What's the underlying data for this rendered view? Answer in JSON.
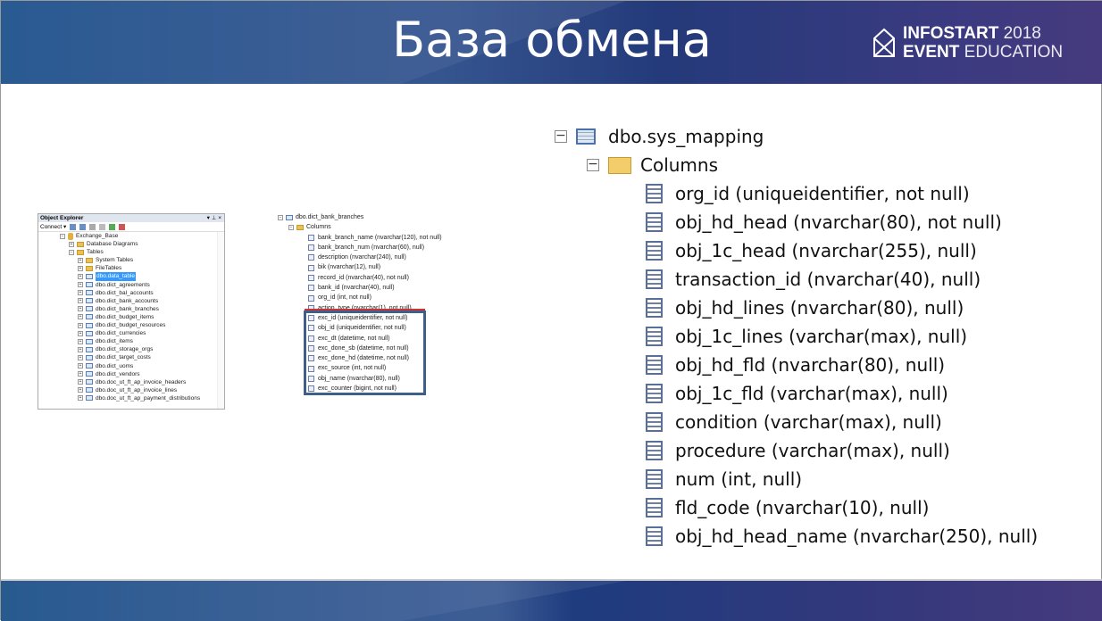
{
  "slide": {
    "title": "База обмена",
    "logo": {
      "line1_bold": "INFOSTART",
      "line1_light": "2018",
      "line2_bold": "EVENT",
      "line2_light": "EDUCATION"
    }
  },
  "object_explorer": {
    "title": "Object Explorer",
    "title_controls": "▾ ⊥ ×",
    "connect_label": "Connect ▾",
    "database": "Exchange_Base",
    "folders": [
      "Database Diagrams",
      "Tables"
    ],
    "sub_folders": [
      "System Tables",
      "FileTables"
    ],
    "tables": [
      "dbo.data_table",
      "dbo.dict_agreements",
      "dbo.dict_bal_accounts",
      "dbo.dict_bank_accounts",
      "dbo.dict_bank_branches",
      "dbo.dict_budget_items",
      "dbo.dict_budget_resources",
      "dbo.dict_currencies",
      "dbo.dict_items",
      "dbo.dict_storage_orgs",
      "dbo.dict_target_costs",
      "dbo.dict_uoms",
      "dbo.dict_vendors",
      "dbo.doc_ut_ft_ap_invoice_headers",
      "dbo.doc_ut_ft_ap_invoice_lines",
      "dbo.doc_ut_ft_ap_payment_distributions"
    ]
  },
  "bank_branches": {
    "table": "dbo.dict_bank_branches",
    "folder": "Columns",
    "columns": [
      "bank_branch_name (nvarchar(120), not null)",
      "bank_branch_num (nvarchar(60), null)",
      "description (nvarchar(240), null)",
      "bik (nvarchar(12), null)",
      "record_id (nvarchar(40), not null)",
      "bank_id (nvarchar(40), null)",
      "org_id (int, not null)",
      "action_type (nvarchar(1), not null)"
    ],
    "exchange_columns": [
      "exc_id (uniqueidentifier, not null)",
      "obj_id (uniqueidentifier, not null)",
      "exc_dt (datetime, not null)",
      "exc_done_sb (datetime, not null)",
      "exc_done_hd (datetime, not null)",
      "exc_source (int, not null)",
      "obj_name (nvarchar(80), null)",
      "exc_counter (bigint, not null)"
    ]
  },
  "sys_mapping": {
    "table": "dbo.sys_mapping",
    "folder": "Columns",
    "columns": [
      "org_id (uniqueidentifier, not null)",
      "obj_hd_head (nvarchar(80), not null)",
      "obj_1c_head (nvarchar(255), null)",
      "transaction_id (nvarchar(40), null)",
      "obj_hd_lines (nvarchar(80), null)",
      "obj_1c_lines (varchar(max), null)",
      "obj_hd_fld (nvarchar(80), null)",
      "obj_1c_fld (varchar(max), null)",
      "condition (varchar(max), null)",
      "procedure (varchar(max), null)",
      "num (int, null)",
      "fld_code (nvarchar(10), null)",
      "obj_hd_head_name (nvarchar(250), null)"
    ]
  }
}
